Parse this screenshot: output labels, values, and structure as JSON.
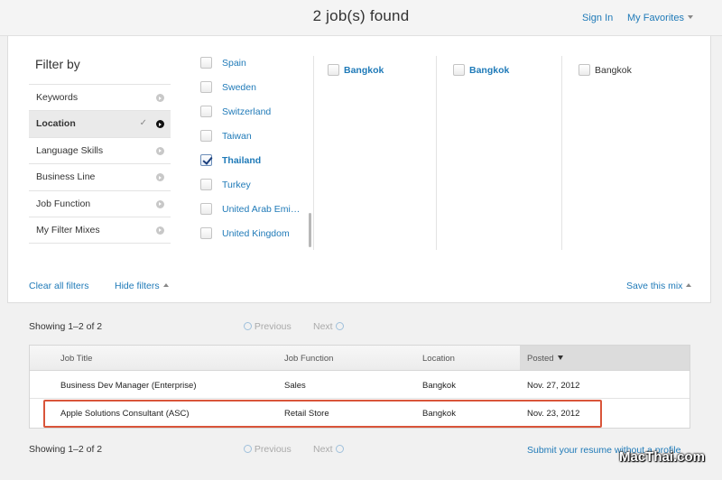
{
  "header": {
    "jobs_found": "2 job(s) found",
    "sign_in": "Sign In",
    "my_favorites": "My Favorites"
  },
  "filters": {
    "title": "Filter by",
    "items": [
      {
        "label": "Keywords",
        "active": false
      },
      {
        "label": "Location",
        "active": true
      },
      {
        "label": "Language Skills",
        "active": false
      },
      {
        "label": "Business Line",
        "active": false
      },
      {
        "label": "Job Function",
        "active": false
      },
      {
        "label": "My Filter Mixes",
        "active": false
      }
    ],
    "active_check": "✓",
    "countries": [
      {
        "label": "Spain",
        "checked": false
      },
      {
        "label": "Sweden",
        "checked": false
      },
      {
        "label": "Switzerland",
        "checked": false
      },
      {
        "label": "Taiwan",
        "checked": false
      },
      {
        "label": "Thailand",
        "checked": true
      },
      {
        "label": "Turkey",
        "checked": false
      },
      {
        "label": "United Arab Emi…",
        "checked": false
      },
      {
        "label": "United Kingdom",
        "checked": false
      }
    ],
    "cities": [
      {
        "label": "Bangkok",
        "style": "link"
      },
      {
        "label": "Bangkok",
        "style": "link"
      },
      {
        "label": "Bangkok",
        "style": "plain"
      }
    ],
    "clear_all": "Clear all filters",
    "hide_filters": "Hide filters",
    "save_mix": "Save this mix"
  },
  "results": {
    "showing": "Showing 1–2 of 2",
    "previous": "Previous",
    "next": "Next",
    "columns": [
      "Job Title",
      "Job Function",
      "Location",
      "Posted"
    ],
    "rows": [
      {
        "title": "Business Dev Manager (Enterprise)",
        "function": "Sales",
        "location": "Bangkok",
        "posted": "Nov. 27, 2012"
      },
      {
        "title": "Apple Solutions Consultant (ASC)",
        "function": "Retail Store",
        "location": "Bangkok",
        "posted": "Nov. 23, 2012"
      }
    ],
    "submit_resume": "Submit your resume without a profile"
  },
  "watermark": "MacThai.com",
  "colors": {
    "link": "#1f7ab8",
    "highlight_box": "#d9553a"
  }
}
